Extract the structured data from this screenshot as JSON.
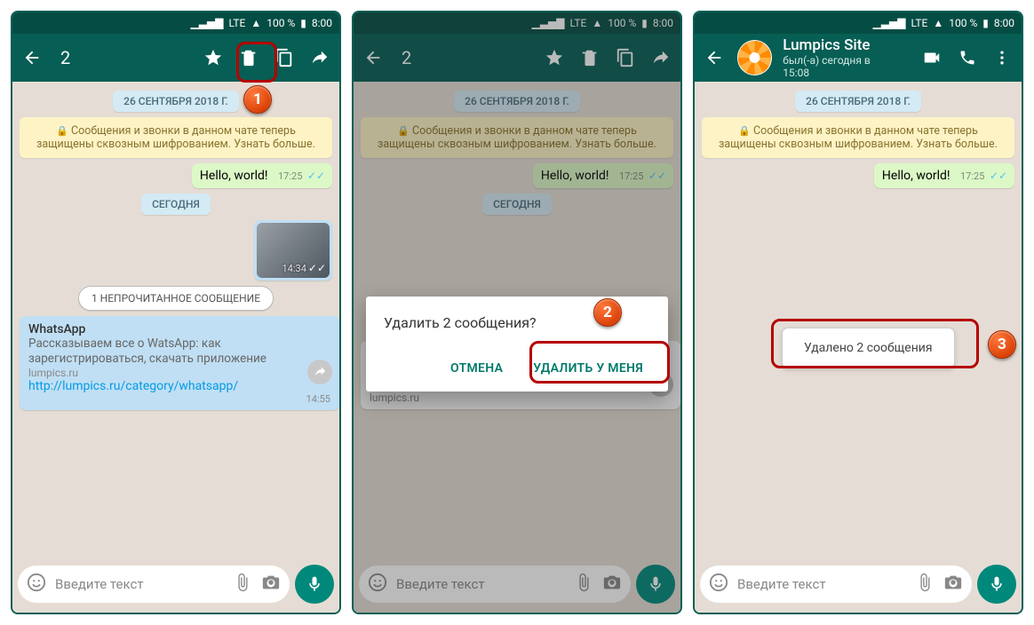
{
  "statusbar": {
    "lte": "LTE",
    "battery": "100 %",
    "time": "8:00"
  },
  "selection": {
    "count": "2"
  },
  "contact": {
    "name": "Lumpics Site",
    "status": "был(-а) сегодня в 15:08"
  },
  "chat": {
    "date": "26 СЕНТЯБРЯ 2018 Г.",
    "encryption_notice": "Сообщения и звонки в данном чате теперь защищены сквозным шифрованием. Узнать больше.",
    "hello_text": "Hello, world!",
    "hello_time": "17:25",
    "today_label": "СЕГОДНЯ",
    "image_time": "14:34",
    "unread_label": "1 НЕПРОЧИТАННОЕ СООБЩЕНИЕ",
    "preview": {
      "title": "WhatsApp",
      "desc_full": "Рассказываем все о WatsApp: как зарегистрироваться, скачать приложение",
      "desc_short": "Рассказываем все о WatsApp: как зарегистрироваться, скачать прил…",
      "site": "lumpics.ru",
      "url": "http://lumpics.ru/category/whatsapp/",
      "time": "14:55"
    }
  },
  "input": {
    "placeholder": "Введите текст"
  },
  "dialog": {
    "title": "Удалить 2 сообщения?",
    "cancel": "ОТМЕНА",
    "delete": "УДАЛИТЬ У МЕНЯ"
  },
  "toast": {
    "deleted": "Удалено 2 сообщения"
  },
  "steps": {
    "s1": "1",
    "s2": "2",
    "s3": "3"
  }
}
